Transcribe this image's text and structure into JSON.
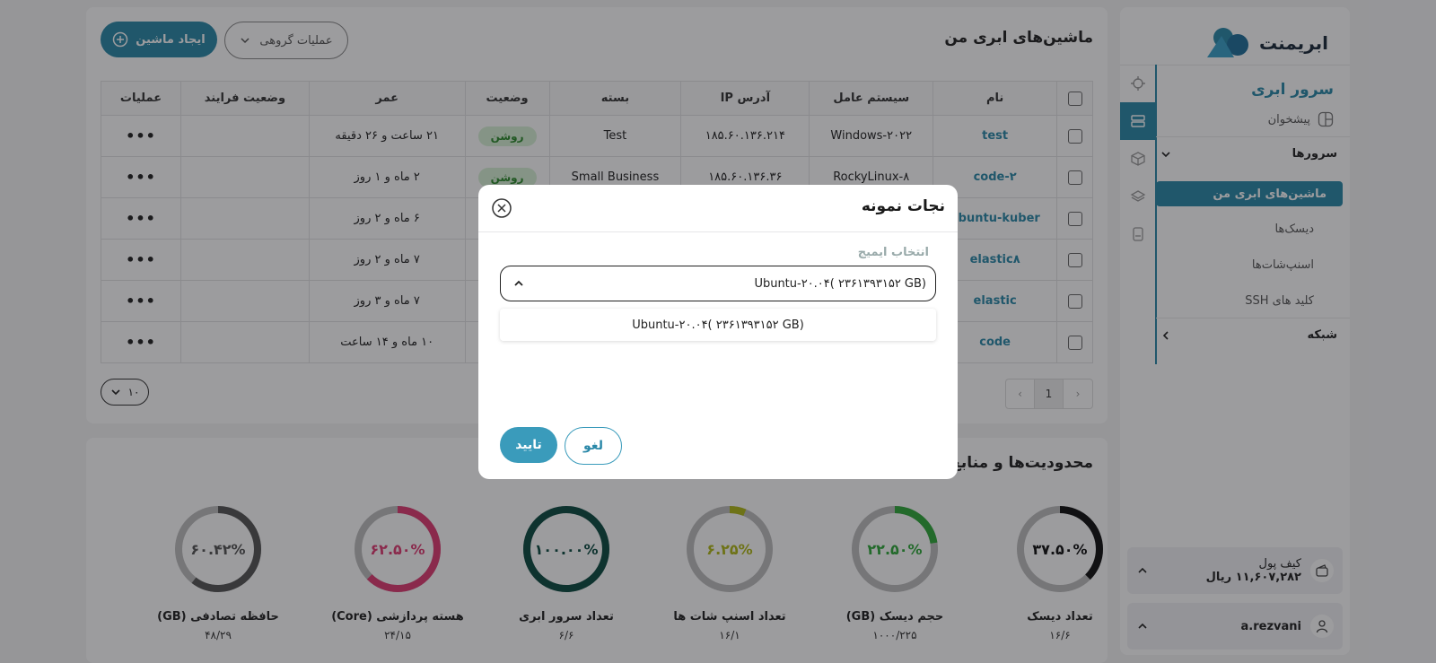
{
  "app": {
    "brand": "ابریمنت"
  },
  "sidebar": {
    "section_title": "سرور ابری",
    "dashboard": "پیشخوان",
    "servers_group": "سرورها",
    "items": [
      {
        "label": "ماشین‌های ابری من",
        "active": true
      },
      {
        "label": "دیسک‌ها"
      },
      {
        "label": "اسنپ‌شات‌ها"
      },
      {
        "label": "کلید های SSH"
      }
    ],
    "network_group": "شبکه",
    "wallet": {
      "title": "کیف پول",
      "amount": "۱۱,۶۰۷,۲۸۲ ریال"
    },
    "user": {
      "name": "a.rezvani"
    }
  },
  "servers": {
    "title": "ماشین‌های ابری من",
    "create_button": "ایجاد ماشین",
    "bulk_button": "عملیات گروهی",
    "columns": [
      "نام",
      "سیستم عامل",
      "آدرس IP",
      "بسته",
      "وضعیت",
      "عمر",
      "وضعیت فرایند",
      "عملیات"
    ],
    "rows": [
      {
        "name": "test",
        "os": "Windows-۲۰۲۲",
        "ip": "۱۸۵.۶۰.۱۳۶.۲۱۴",
        "plan": "Test",
        "status": "روشن",
        "age": "۲۱ ساعت و ۲۶ دقیقه",
        "process": ""
      },
      {
        "name": "code-۲",
        "os": "RockyLinux-۸",
        "ip": "۱۸۵.۶۰.۱۳۶.۳۶",
        "plan": "Small Business",
        "status": "روشن",
        "age": "۲ ماه و ۱ روز",
        "process": ""
      },
      {
        "name": "ubuntu-kuber",
        "os": "",
        "ip": "",
        "plan": "",
        "status": "",
        "age": "۶ ماه و ۲ روز",
        "process": ""
      },
      {
        "name": "elastic۸",
        "os": "",
        "ip": "",
        "plan": "",
        "status": "",
        "age": "۷ ماه و ۲ روز",
        "process": ""
      },
      {
        "name": "elastic",
        "os": "",
        "ip": "",
        "plan": "",
        "status": "",
        "age": "۷ ماه و ۳ روز",
        "process": ""
      },
      {
        "name": "code",
        "os": "",
        "ip": "",
        "plan": "",
        "status": "",
        "age": "۱۰ ماه و ۱۴ ساعت",
        "process": ""
      }
    ],
    "actions_glyph": "•••",
    "page": "1",
    "per_page": "۱۰"
  },
  "limits": {
    "title": "محدودیت‌ها و منابع",
    "gauges": [
      {
        "label": "تعداد دیسک",
        "percent_text": "۳۷.۵۰%",
        "fraction": 0.375,
        "value": "۱۶/۶",
        "color": "#111111"
      },
      {
        "label": "حجم دیسک (GB)",
        "percent_text": "۲۲.۵۰%",
        "fraction": 0.225,
        "value": "۱۰۰۰/۲۲۵",
        "color": "#2faa3a"
      },
      {
        "label": "تعداد اسنپ شات ها",
        "percent_text": "۶.۲۵%",
        "fraction": 0.0625,
        "value": "۱۶/۱",
        "color": "#b0b818"
      },
      {
        "label": "تعداد سرور ابری",
        "percent_text": "۱۰۰.۰۰%",
        "fraction": 1.0,
        "value": "۶/۶",
        "color": "#0b4a40"
      },
      {
        "label": "هسته پردازشی (Core)",
        "percent_text": "۶۲.۵۰%",
        "fraction": 0.625,
        "value": "۲۴/۱۵",
        "color": "#e03b73"
      },
      {
        "label": "حافظه تصادفی (GB)",
        "percent_text": "۶۰.۴۲%",
        "fraction": 0.6042,
        "value": "۴۸/۲۹",
        "color": "#555555"
      }
    ]
  },
  "modal": {
    "title": "نجات نمونه",
    "field_label": "انتخاب ایمیج",
    "selected": "Ubuntu-۲۰.۰۴( ۲۳۶۱۳۹۳۱۵۲ GB)",
    "options": [
      "Ubuntu-۲۰.۰۴( ۲۳۶۱۳۹۳۱۵۲ GB)"
    ],
    "confirm": "تایید",
    "cancel": "لغو"
  }
}
